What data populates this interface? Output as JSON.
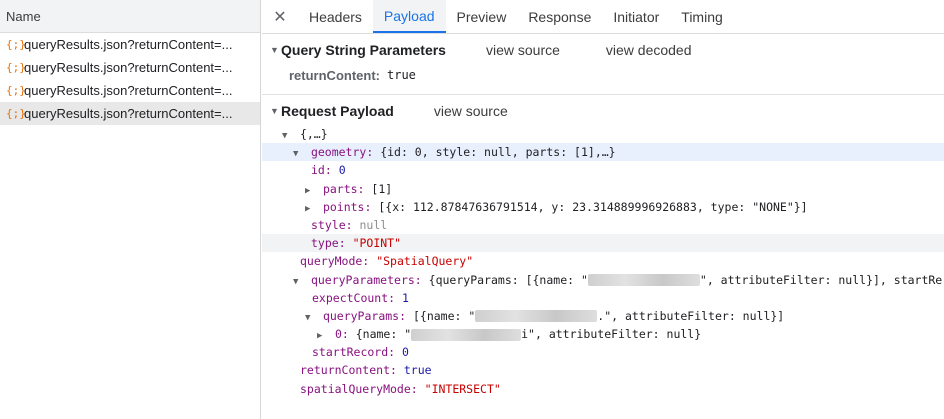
{
  "left": {
    "header": "Name",
    "requests": [
      {
        "icon": "{;}",
        "label": "queryResults.json?returnContent=..."
      },
      {
        "icon": "{;}",
        "label": "queryResults.json?returnContent=..."
      },
      {
        "icon": "{;}",
        "label": "queryResults.json?returnContent=..."
      },
      {
        "icon": "{;}",
        "label": "queryResults.json?returnContent=..."
      }
    ]
  },
  "tabs": [
    "Headers",
    "Payload",
    "Preview",
    "Response",
    "Initiator",
    "Timing"
  ],
  "active_tab": "Payload",
  "close_glyph": "✕",
  "qs": {
    "title": "Query String Parameters",
    "view_source": "view source",
    "view_decoded": "view decoded",
    "key": "returnContent:",
    "value": "true"
  },
  "payload": {
    "title": "Request Payload",
    "view_source": "view source",
    "root": "{,…}",
    "geometry_key": "geometry:",
    "geometry_summary": "{id: 0, style: null, parts: [1],…}",
    "id_key": "id:",
    "id_val": "0",
    "parts_key": "parts:",
    "parts_val": "[1]",
    "points_key": "points:",
    "points_val": "[{x: 112.87847636791514, y: 23.314889996926883, type: \"NONE\"}]",
    "style_key": "style:",
    "style_val": "null",
    "type_key": "type:",
    "type_val": "\"POINT\"",
    "querymode_key": "queryMode:",
    "querymode_val": "\"SpatialQuery\"",
    "qp_key": "queryParameters:",
    "qp_summary_a": "{queryParams: [{name: \"",
    "qp_summary_b": "\", attributeFilter: null}], startRe",
    "expect_key": "expectCount:",
    "expect_val": "1",
    "qparams_key": "queryParams:",
    "qparams_a": "[{name: \"",
    "qparams_b": ".\", attributeFilter: null}]",
    "item0_key": "0:",
    "item0_a": "{name: \"",
    "item0_b": "i\", attributeFilter: null}",
    "start_key": "startRecord:",
    "start_val": "0",
    "rc_key": "returnContent:",
    "rc_val": "true",
    "sqm_key": "spatialQueryMode:",
    "sqm_val": "\"INTERSECT\""
  }
}
